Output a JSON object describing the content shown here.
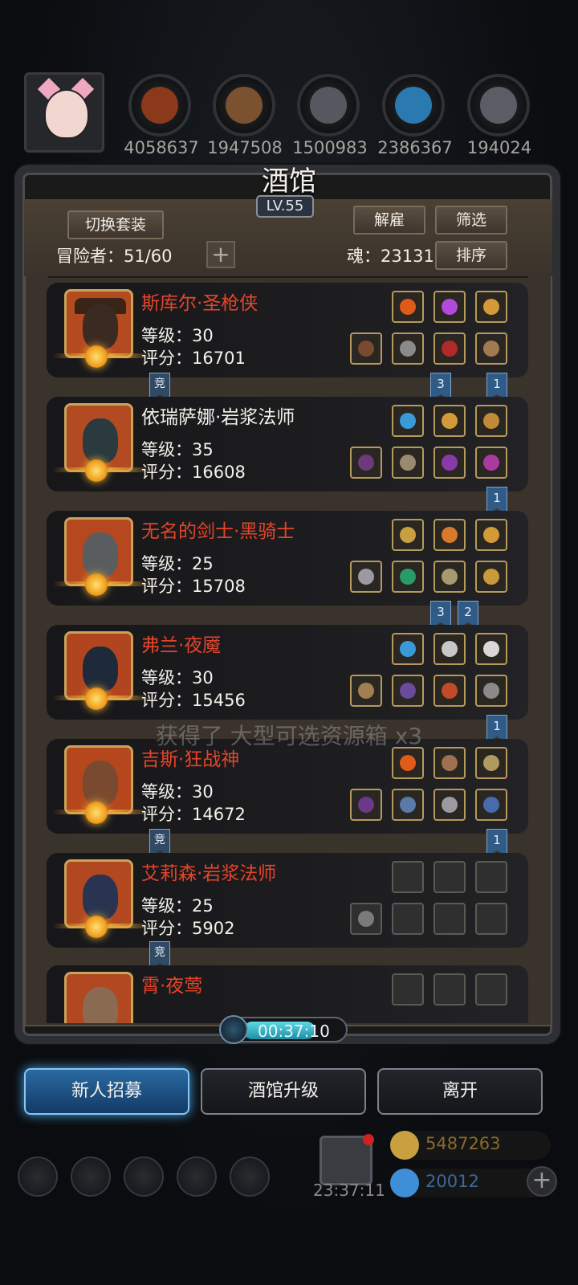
{
  "top_resources": [
    {
      "icon": "meat-icon",
      "value": "4058637",
      "color": "#8a3a1a"
    },
    {
      "icon": "wood-icon",
      "value": "1947508",
      "color": "#7a5230"
    },
    {
      "icon": "stone-icon",
      "value": "1500983",
      "color": "#55585e"
    },
    {
      "icon": "crystal-icon",
      "value": "2386367",
      "color": "#2a7ab0"
    },
    {
      "icon": "iron-icon",
      "value": "194024",
      "color": "#5a5d63"
    }
  ],
  "header": {
    "title": "酒馆",
    "level": "LV.55",
    "switch_set_label": "切换套装",
    "dismiss_label": "解雇",
    "filter_label": "筛选",
    "sort_label": "排序",
    "adventurers_label": "冒险者：51/60",
    "soul_label": "魂：23131"
  },
  "heroes": [
    {
      "name": "斯库尔·圣枪侠",
      "level": "等级：30",
      "score": "评分：16701",
      "name_color": "red",
      "portrait": "#b8461c"
    },
    {
      "name": "依瑞萨娜·岩浆法师",
      "level": "等级：35",
      "score": "评分：16608",
      "name_color": "white",
      "portrait": "#b24a22"
    },
    {
      "name": "无名的剑士·黑骑士",
      "level": "等级：25",
      "score": "评分：15708",
      "name_color": "red",
      "portrait": "#b5481f"
    },
    {
      "name": "弗兰·夜魇",
      "level": "等级：30",
      "score": "评分：15456",
      "name_color": "red",
      "portrait": "#b0451f"
    },
    {
      "name": "吉斯·狂战神",
      "level": "等级：30",
      "score": "评分：14672",
      "name_color": "red",
      "portrait": "#b6471d"
    },
    {
      "name": "艾莉森·岩浆法师",
      "level": "等级：25",
      "score": "评分：5902",
      "name_color": "red",
      "portrait": "#b14820"
    },
    {
      "name": "霄·夜莺",
      "level": "",
      "score": "",
      "name_color": "red",
      "portrait": "#b14820"
    }
  ],
  "flags": {
    "jing": "竞",
    "three": "3",
    "two": "2",
    "one": "1"
  },
  "toast": "获得了 大型可选资源箱 x3",
  "timer": "00:37:10",
  "buttons": {
    "recruit": "新人招募",
    "upgrade": "酒馆升级",
    "leave": "离开"
  },
  "gift_timer": "23:37:11",
  "currency": {
    "gold": "5487263",
    "gems": "20012"
  },
  "colors": {
    "name_red": "#e4452a",
    "gold": "#c8a040",
    "gems": "#3f8fd8"
  }
}
